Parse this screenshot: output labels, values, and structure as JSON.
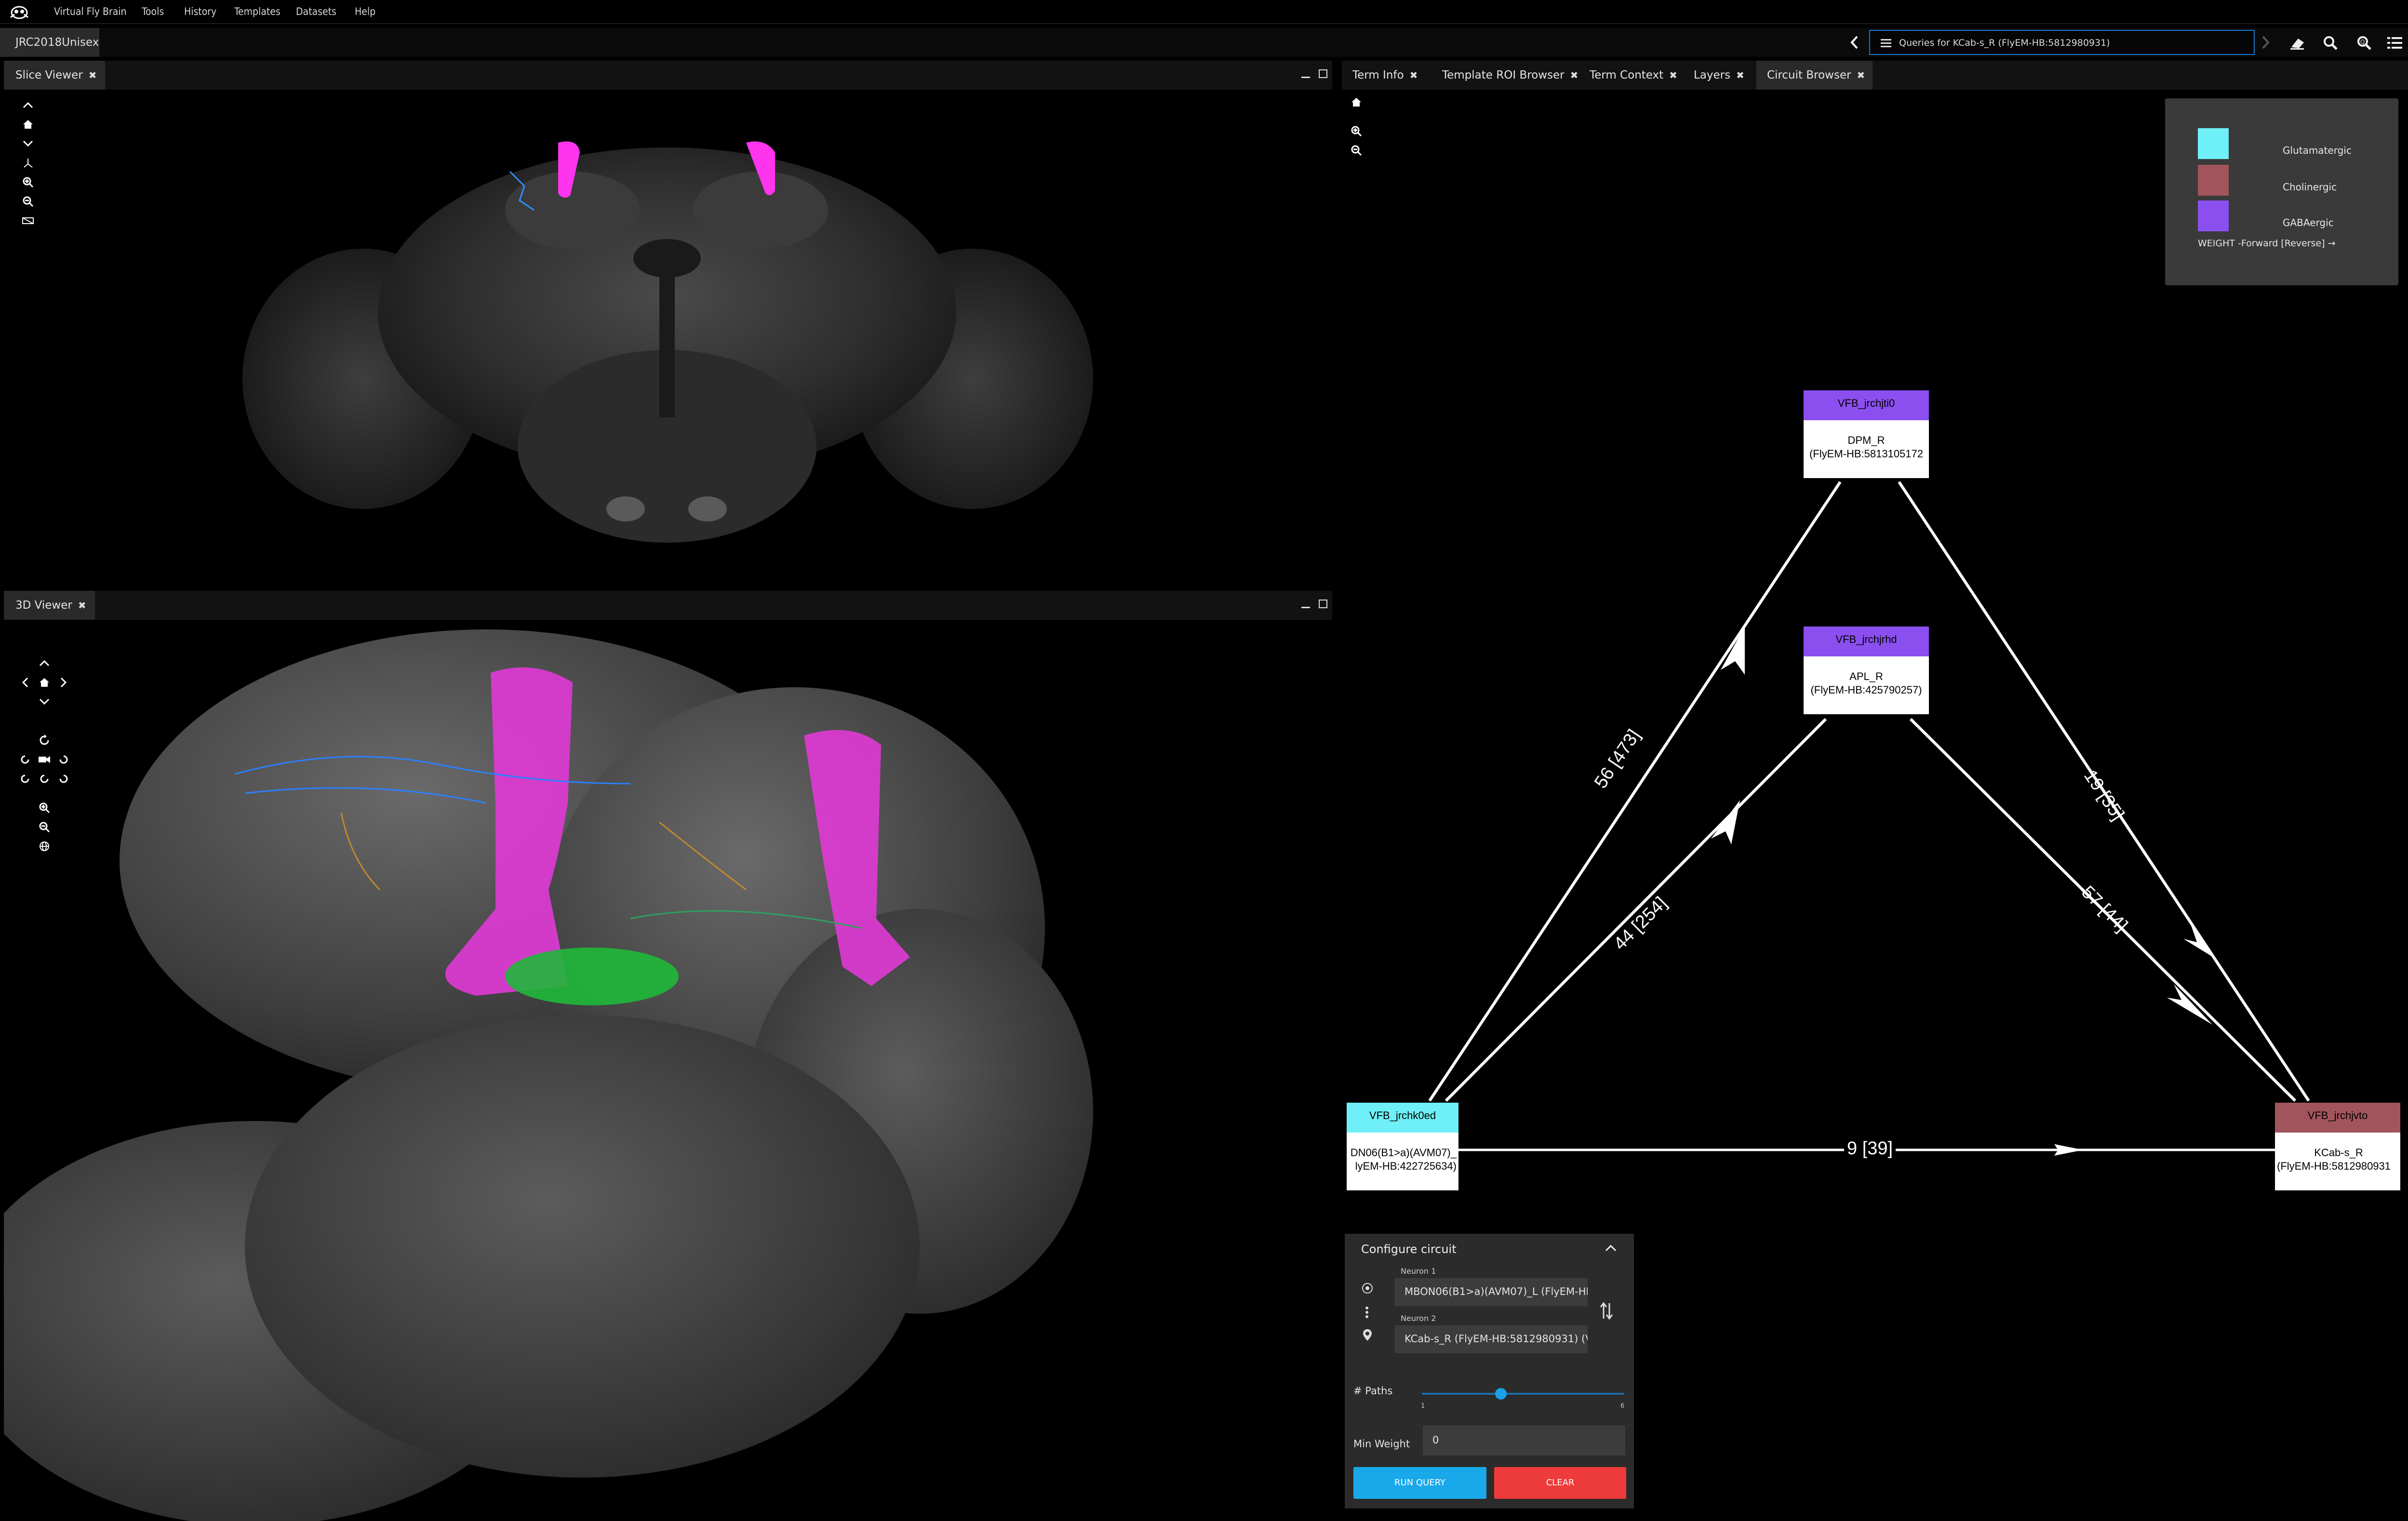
{
  "menu": {
    "items": [
      "Virtual Fly Brain",
      "Tools",
      "History",
      "Templates",
      "Datasets",
      "Help"
    ]
  },
  "querybar": {
    "template_tab": "JRC2018Unisex",
    "query_text": "Queries for KCab-s_R (FlyEM-HB:5812980931)"
  },
  "slice_viewer": {
    "tab_label": "Slice Viewer"
  },
  "viewer_3d": {
    "tab_label": "3D Viewer"
  },
  "right_tabs": [
    "Term Info",
    "Template ROI Browser",
    "Term Context",
    "Layers",
    "Circuit Browser"
  ],
  "legend": {
    "items": [
      {
        "label": "Glutamatergic",
        "color": "#6ff0f8"
      },
      {
        "label": "Cholinergic",
        "color": "#a2545c"
      },
      {
        "label": "GABAergic",
        "color": "#8b4ff0"
      }
    ],
    "weight_label": "WEIGHT -Forward [Reverse] →"
  },
  "graph": {
    "nodes": [
      {
        "id": "VFB_jrchjti0",
        "title": "VFB_jrchjti0",
        "name": "DPM_R",
        "ref": "(FlyEM-HB:5813105172",
        "color": "#8b4ff0"
      },
      {
        "id": "VFB_jrchjrhd",
        "title": "VFB_jrchjrhd",
        "name": "APL_R",
        "ref": "(FlyEM-HB:425790257)",
        "color": "#8b4ff0"
      },
      {
        "id": "VFB_jrchk0ed",
        "title": "VFB_jrchk0ed",
        "name": "DN06(B1>a)(AVM07)_",
        "ref": "lyEM-HB:422725634)",
        "color": "#6ff0f8"
      },
      {
        "id": "VFB_jrchjvto",
        "title": "VFB_jrchjvto",
        "name": "KCab-s_R",
        "ref": "(FlyEM-HB:5812980931",
        "color": "#a2545c"
      }
    ],
    "edges": [
      {
        "label": "56 [473]"
      },
      {
        "label": "44 [254]"
      },
      {
        "label": "19 [35]"
      },
      {
        "label": "57 [44]"
      },
      {
        "label": "9 [39]"
      }
    ]
  },
  "configure": {
    "title": "Configure circuit",
    "neuron1_label": "Neuron 1",
    "neuron1_value": "MBON06(B1>a)(AVM07)_L (FlyEM-HB:...",
    "neuron2_label": "Neuron 2",
    "neuron2_value": "KCab-s_R (FlyEM-HB:5812980931) (V...",
    "paths_label": "# Paths",
    "paths_min": "1",
    "paths_max": "6",
    "paths_value": 3,
    "min_weight_label": "Min Weight",
    "min_weight_value": "0",
    "run_label": "RUN QUERY",
    "clear_label": "CLEAR"
  }
}
